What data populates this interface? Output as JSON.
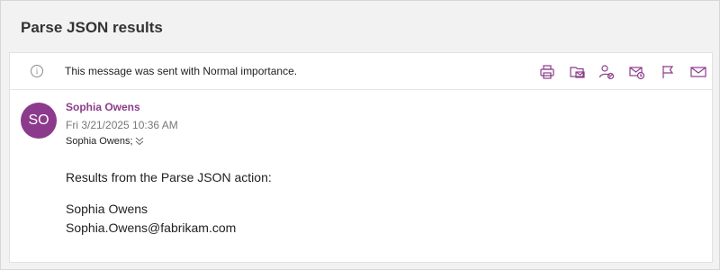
{
  "message": {
    "subject": "Parse JSON results",
    "importance_text": "This message was sent with Normal importance.",
    "sender_initials": "SO",
    "sender_name": "Sophia Owens",
    "datetime": "Fri 3/21/2025  10:36 AM",
    "recipients": "Sophia Owens;",
    "body_intro": "Results from the Parse JSON action:",
    "body_name": "Sophia Owens",
    "body_email": "Sophia.Owens@fabrikam.com"
  },
  "toolbar": {
    "icons": [
      "print-icon",
      "move-to-folder-icon",
      "block-sender-icon",
      "read-receipt-icon",
      "flag-icon",
      "mail-icon"
    ]
  },
  "colors": {
    "accent": "#8b3d8b",
    "avatar": "#8c3a8c",
    "background": "#f2f2f2"
  }
}
